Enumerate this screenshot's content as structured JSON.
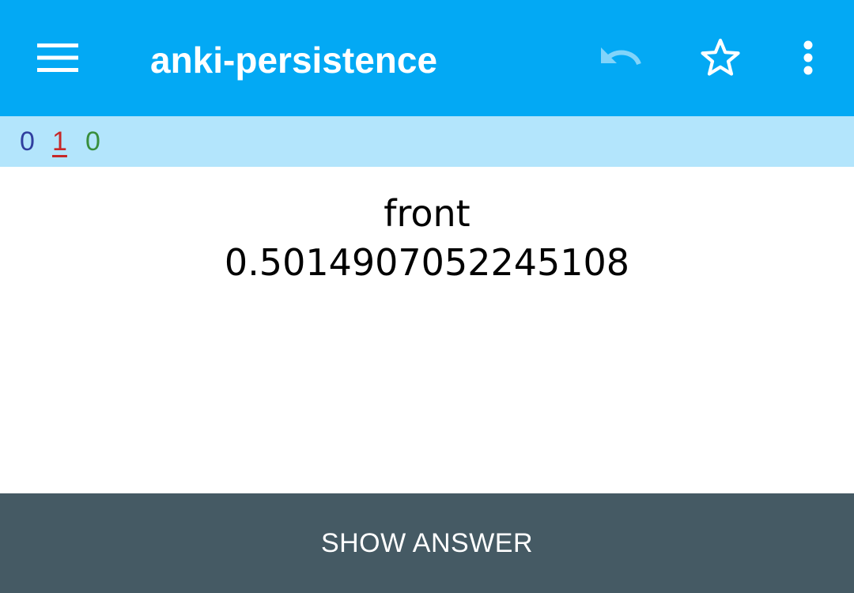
{
  "app": {
    "title": "anki-persistence"
  },
  "toolbar": {
    "menu_icon": "hamburger-menu-icon",
    "undo_icon": "undo-icon",
    "star_icon": "star-outline-icon",
    "overflow_icon": "more-vert-icon"
  },
  "counts": {
    "new": "0",
    "learn": "1",
    "review": "0"
  },
  "card": {
    "front_label": "front",
    "value": "0.5014907052245108"
  },
  "answer_bar": {
    "label": "SHOW ANSWER"
  },
  "colors": {
    "toolbar": "#03a9f4",
    "counts_bar": "#b3e5fc",
    "new_count": "#303f9f",
    "learn_count": "#c62828",
    "review_count": "#388e3c",
    "answer_bar": "#455a64",
    "undo_icon_disabled": "#81d4fa"
  }
}
